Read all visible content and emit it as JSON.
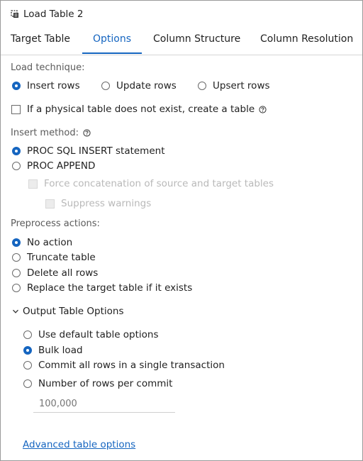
{
  "window": {
    "title": "Load Table 2"
  },
  "tabs": [
    {
      "label": "Target Table"
    },
    {
      "label": "Options"
    },
    {
      "label": "Column Structure"
    },
    {
      "label": "Column Resolution"
    }
  ],
  "load_technique": {
    "label": "Load technique:",
    "options": [
      {
        "label": "Insert rows",
        "checked": true
      },
      {
        "label": "Update rows",
        "checked": false
      },
      {
        "label": "Upsert rows",
        "checked": false
      }
    ],
    "create_table_label": "If a physical table does not exist, create a table"
  },
  "insert_method": {
    "label": "Insert method:",
    "options": [
      {
        "label": "PROC SQL INSERT statement",
        "checked": true
      },
      {
        "label": "PROC APPEND",
        "checked": false
      }
    ],
    "force_concat_label": "Force concatenation of source and target tables",
    "suppress_warnings_label": "Suppress warnings"
  },
  "preprocess": {
    "label": "Preprocess actions:",
    "options": [
      {
        "label": "No action",
        "checked": true
      },
      {
        "label": "Truncate table",
        "checked": false
      },
      {
        "label": "Delete all rows",
        "checked": false
      },
      {
        "label": "Replace the target table if it exists",
        "checked": false
      }
    ]
  },
  "output_table": {
    "section_label": "Output Table Options",
    "options": [
      {
        "label": "Use default table options",
        "checked": false
      },
      {
        "label": "Bulk load",
        "checked": true
      },
      {
        "label": "Commit all rows in a single transaction",
        "checked": false
      },
      {
        "label": "Number of rows per commit",
        "checked": false
      }
    ],
    "rows_per_commit_placeholder": "100,000"
  },
  "advanced_link": "Advanced table options",
  "colors": {
    "accent": "#1565c0",
    "disabled_text": "#b9b9b9",
    "section_label": "#5b5b5b"
  }
}
